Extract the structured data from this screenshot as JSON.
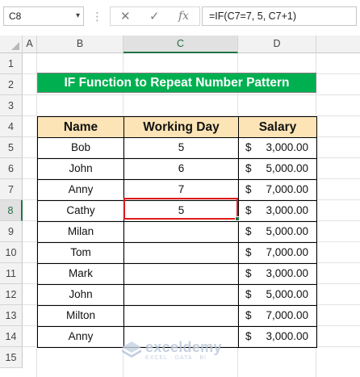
{
  "formula_bar": {
    "name_box": "C8",
    "cancel_icon": "✕",
    "enter_icon": "✓",
    "fx_label": "fx",
    "formula": "=IF(C7=7, 5, C7+1)"
  },
  "columns": [
    "A",
    "B",
    "C",
    "D"
  ],
  "rows": [
    "1",
    "2",
    "3",
    "4",
    "5",
    "6",
    "7",
    "8",
    "9",
    "10",
    "11",
    "12",
    "13",
    "14",
    "15"
  ],
  "selected_cell": "C8",
  "title": "IF Function to Repeat Number Pattern",
  "table": {
    "headers": [
      "Name",
      "Working Day",
      "Salary"
    ],
    "currency": "$",
    "rows": [
      {
        "name": "Bob",
        "day": "5",
        "salary": "3,000.00"
      },
      {
        "name": "John",
        "day": "6",
        "salary": "5,000.00"
      },
      {
        "name": "Anny",
        "day": "7",
        "salary": "7,000.00"
      },
      {
        "name": "Cathy",
        "day": "5",
        "salary": "3,000.00"
      },
      {
        "name": "Milan",
        "day": "",
        "salary": "5,000.00"
      },
      {
        "name": "Tom",
        "day": "",
        "salary": "7,000.00"
      },
      {
        "name": "Mark",
        "day": "",
        "salary": "3,000.00"
      },
      {
        "name": "John",
        "day": "",
        "salary": "5,000.00"
      },
      {
        "name": "Milton",
        "day": "",
        "salary": "7,000.00"
      },
      {
        "name": "Anny",
        "day": "",
        "salary": "3,000.00"
      }
    ]
  },
  "watermark": {
    "brand": "exceldemy",
    "tagline": "EXCEL · DATA · BI"
  },
  "colors": {
    "title_bg": "#00b050",
    "header_bg": "#fce4b6",
    "active_border": "#e01a1a",
    "excel_green": "#217346"
  }
}
